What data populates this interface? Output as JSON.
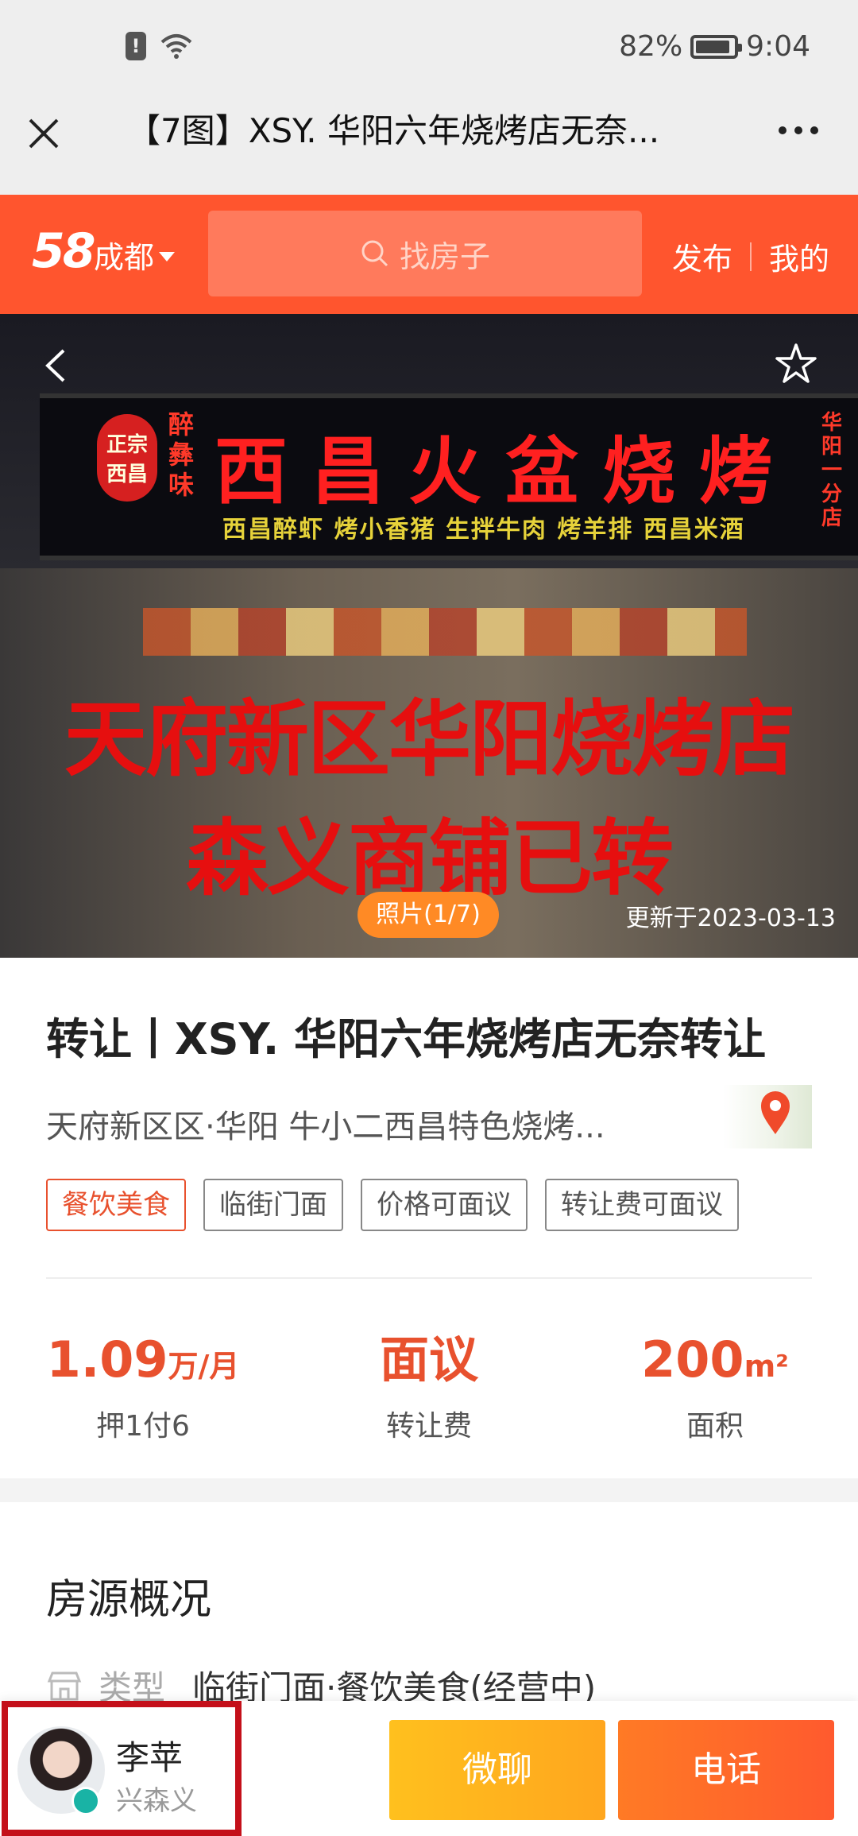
{
  "status_bar": {
    "battery": "82%",
    "time": "9:04"
  },
  "browser": {
    "title": "【7图】XSY. 华阳六年烧烤店无奈..."
  },
  "nav": {
    "logo": "58",
    "city": "成都",
    "search_placeholder": "找房子",
    "publish": "发布",
    "mine": "我的"
  },
  "hero": {
    "sign_badge": "正宗西昌",
    "sign_side": "醉彝味",
    "sign_main": "西昌火盆烧烤",
    "sign_sub": "西昌醉虾 烤小香猪 生拌牛肉 烤羊排 西昌米酒",
    "sign_right": "华阳一分店",
    "overlay_line1": "天府新区华阳烧烤店",
    "overlay_line2": "森义商铺已转",
    "photo_count": "照片(1/7)",
    "updated": "更新于2023-03-13"
  },
  "listing": {
    "title": "转让丨XSY. 华阳六年烧烤店无奈转让",
    "location": "天府新区区·华阳 牛小二西昌特色烧烤...",
    "tags": [
      "餐饮美食",
      "临街门面",
      "价格可面议",
      "转让费可面议"
    ],
    "stats": [
      {
        "value": "1.09",
        "unit": "万/月",
        "label": "押1付6"
      },
      {
        "value": "面议",
        "unit": "",
        "label": "转让费"
      },
      {
        "value": "200",
        "unit": "m²",
        "label": "面积"
      }
    ]
  },
  "overview": {
    "title": "房源概况",
    "type_label": "类型",
    "type_value": "临街门面·餐饮美食(经营中)"
  },
  "agent": {
    "name": "李苹",
    "company": "兴森义"
  },
  "actions": {
    "chat": "微聊",
    "call": "电话"
  },
  "colors": {
    "brand": "#ff552e",
    "accent": "#e8512e",
    "chat": "#ffb41e",
    "call": "#ff6a2a"
  }
}
